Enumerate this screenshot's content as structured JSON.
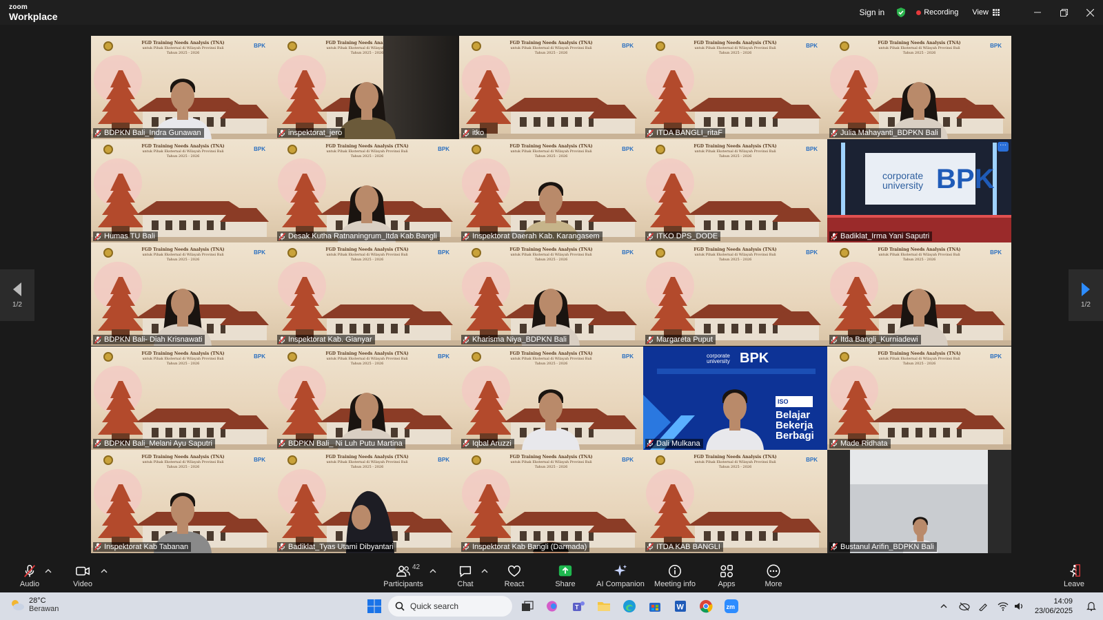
{
  "window": {
    "logo_top": "zoom",
    "logo_bottom": "Workplace",
    "sign_in": "Sign in",
    "recording": "Recording",
    "view": "View"
  },
  "slide": {
    "line1": "FGD Training Needs Analysis (TNA)",
    "line2": "untuk Pihak Eksternal di Wilayah Provinsi Bali",
    "line3": "Tahun 2025 - 2026",
    "brand": "BPK"
  },
  "participants": [
    {
      "name": "BDPKN Bali_Indra Gunawan",
      "bg": "slide",
      "person": "man"
    },
    {
      "name": "inspektorat_jero",
      "bg": "office",
      "person": "woman"
    },
    {
      "name": "itko",
      "bg": "slide",
      "person": "none"
    },
    {
      "name": "ITDA BANGLI_ritaF",
      "bg": "slide",
      "person": "none"
    },
    {
      "name": "Julia Mahayanti_BDPKN Bali",
      "bg": "slide",
      "person": "woman",
      "active": true
    },
    {
      "name": "Humas TU Bali",
      "bg": "slide",
      "person": "none"
    },
    {
      "name": "Desak Kutha Ratnaningrum_Itda Kab.Bangli",
      "bg": "slide",
      "person": "woman"
    },
    {
      "name": "Inspektorat Daerah Kab. Karangasem",
      "bg": "slide",
      "person": "man"
    },
    {
      "name": "ITKO DPS_DODE",
      "bg": "slide",
      "person": "none"
    },
    {
      "name": "Badiklat_Irma Yani Saputri",
      "bg": "studio",
      "person": "none"
    },
    {
      "name": "BDPKN Bali- Diah Krisnawati",
      "bg": "slide",
      "person": "woman"
    },
    {
      "name": "Inspektorat Kab. Gianyar",
      "bg": "slide",
      "person": "none"
    },
    {
      "name": "Kharisma Niya_BDPKN Bali",
      "bg": "slide",
      "person": "woman"
    },
    {
      "name": "Margareta Puput",
      "bg": "slide",
      "person": "none"
    },
    {
      "name": "Itda Bangli_Kurniadewi",
      "bg": "slide",
      "person": "woman"
    },
    {
      "name": "BDPKN Bali_Melani Ayu Saputri",
      "bg": "slide",
      "person": "none"
    },
    {
      "name": "BDPKN Bali_ Ni Luh Putu Martina",
      "bg": "slide",
      "person": "woman"
    },
    {
      "name": "Iqbal Aruzzi",
      "bg": "slide",
      "person": "man"
    },
    {
      "name": "Dali Mulkana",
      "bg": "blue",
      "person": "man"
    },
    {
      "name": "Made Ridhata",
      "bg": "slide",
      "person": "none"
    },
    {
      "name": "Inspektorat Kab Tabanan",
      "bg": "slide",
      "person": "man"
    },
    {
      "name": "Badiklat_Tyas Utami Dibyantari",
      "bg": "slide",
      "person": "hijab"
    },
    {
      "name": "Inspektorat Kab Bangli (Darmada)",
      "bg": "slide",
      "person": "head"
    },
    {
      "name": "ITDA KAB BANGLI",
      "bg": "slide",
      "person": "none"
    },
    {
      "name": "Bustanul Arifin_BDPKN Bali",
      "bg": "dark",
      "person": "man"
    }
  ],
  "studio": {
    "line1": "corporate",
    "line2": "university",
    "brand": "BPK"
  },
  "bluebg": {
    "line1": "corporate",
    "line2": "university",
    "brand": "BPK",
    "tag1": "Belajar",
    "tag2": "Bekerja",
    "tag3": "Berbagi",
    "iso": "ISO"
  },
  "pager": {
    "left": "1/2",
    "right": "1/2"
  },
  "toolbar": {
    "audio": "Audio",
    "video": "Video",
    "participants": "Participants",
    "participant_count": "42",
    "chat": "Chat",
    "react": "React",
    "share": "Share",
    "ai": "AI Companion",
    "meeting_info": "Meeting info",
    "apps": "Apps",
    "more": "More",
    "leave": "Leave"
  },
  "taskbar": {
    "temp": "28°C",
    "weather": "Berawan",
    "search": "Quick search",
    "time": "14:09",
    "date": "23/06/2025"
  },
  "colors": {
    "accent_green": "#3ddc84",
    "record_red": "#e5393b",
    "share_green": "#1fb84f",
    "bg": "#1a1a1a"
  }
}
